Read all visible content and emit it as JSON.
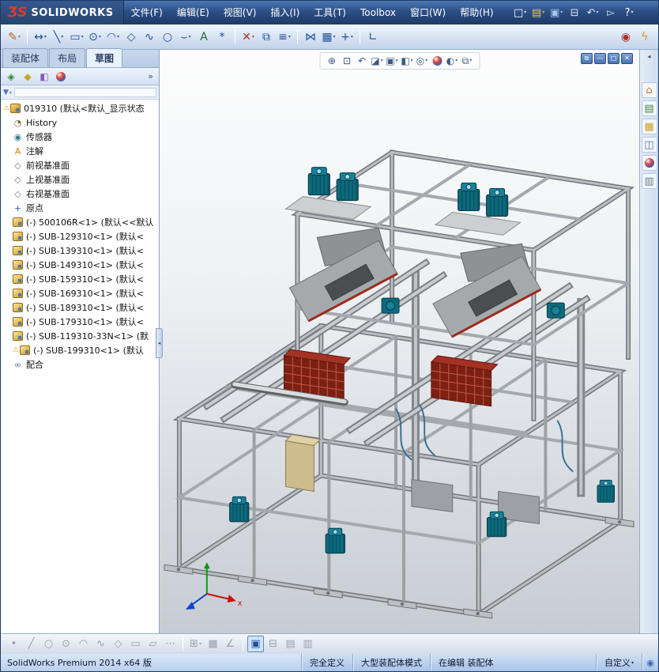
{
  "colors": {
    "titlebar_blue": "#2c4f86",
    "toolbar_blue": "#d6e2f3",
    "statusbar_blue": "#a9c4e8",
    "selection_blue": "#316ac5",
    "brand_red": "#e03a2a",
    "motor_teal": "#0c6b7d",
    "frame_gray": "#a5a9ae",
    "bin_red": "#7c2014"
  },
  "titlebar": {
    "logo_prefix": "ƷS",
    "logo_text": "SOLIDWORKS",
    "menus": [
      {
        "name": "file",
        "label": "文件(F)"
      },
      {
        "name": "edit",
        "label": "编辑(E)"
      },
      {
        "name": "view",
        "label": "视图(V)"
      },
      {
        "name": "insert",
        "label": "插入(I)"
      },
      {
        "name": "tools",
        "label": "工具(T)"
      },
      {
        "name": "toolbox",
        "label": "Toolbox"
      },
      {
        "name": "window",
        "label": "窗口(W)"
      },
      {
        "name": "help",
        "label": "帮助(H)"
      }
    ],
    "quick_icons": [
      {
        "name": "new-document-icon",
        "glyph": "□",
        "color": "#ffffff",
        "caret": true
      },
      {
        "name": "open-icon",
        "glyph": "▤",
        "color": "#f0c64a",
        "caret": true
      },
      {
        "name": "save-icon",
        "glyph": "▣",
        "color": "#a8c8f0",
        "caret": true
      },
      {
        "name": "print-icon",
        "glyph": "⊟",
        "color": "#d8e4f5"
      },
      {
        "name": "undo-icon",
        "glyph": "↶",
        "color": "#d8e4f5",
        "caret": true
      },
      {
        "name": "select-arrow-icon",
        "glyph": "▻",
        "color": "#d8e4f5"
      },
      {
        "name": "help-icon",
        "glyph": "?",
        "color": "#ffffff",
        "caret": true
      }
    ]
  },
  "sketch_toolbar": {
    "icons": [
      {
        "name": "sketch-icon",
        "glyph": "✎",
        "color": "#b8641f",
        "caret": true
      },
      {
        "name": "smart-dimension-icon",
        "glyph": "↔",
        "color": "#1f4e9e",
        "caret": true,
        "sep": true
      },
      {
        "name": "line-icon",
        "glyph": "╲",
        "color": "#1f4e9e",
        "caret": true
      },
      {
        "name": "rectangle-icon",
        "glyph": "▭",
        "color": "#1f4e9e",
        "caret": true
      },
      {
        "name": "circle-icon",
        "glyph": "⊙",
        "color": "#1f4e9e",
        "caret": true
      },
      {
        "name": "arc-icon",
        "glyph": "◠",
        "color": "#1f4e9e",
        "caret": true
      },
      {
        "name": "polygon-icon",
        "glyph": "◇",
        "color": "#1f4e9e"
      },
      {
        "name": "spline-icon",
        "glyph": "∿",
        "color": "#1f4e9e"
      },
      {
        "name": "ellipse-icon",
        "glyph": "○",
        "color": "#1f4e9e"
      },
      {
        "name": "fillet-icon",
        "glyph": "⌣",
        "color": "#1f4e9e",
        "caret": true
      },
      {
        "name": "text-icon",
        "glyph": "A",
        "color": "#1f6e2e"
      },
      {
        "name": "point-icon",
        "glyph": "*",
        "color": "#1f4e9e"
      },
      {
        "name": "trim-entities-icon",
        "glyph": "✕",
        "color": "#b03020",
        "caret": true,
        "sep": true
      },
      {
        "name": "convert-entities-icon",
        "glyph": "⧉",
        "color": "#1f4e9e"
      },
      {
        "name": "offset-entities-icon",
        "glyph": "≡",
        "color": "#1f4e9e",
        "caret": true
      },
      {
        "name": "mirror-entities-icon",
        "glyph": "⋈",
        "color": "#1f4e9e",
        "sep": true
      },
      {
        "name": "linear-pattern-icon",
        "glyph": "▦",
        "color": "#1f4e9e",
        "caret": true
      },
      {
        "name": "move-entities-icon",
        "glyph": "+",
        "color": "#1f4e9e",
        "caret": true
      },
      {
        "name": "display-relations-icon",
        "glyph": "∟",
        "color": "#1f4e9e",
        "sep": true
      }
    ],
    "right_icons": [
      {
        "name": "options-icon",
        "glyph": "◉",
        "color": "#b03020"
      },
      {
        "name": "rebuild-lightning-icon",
        "glyph": "ϟ",
        "color": "#d4a017"
      }
    ]
  },
  "command_tabs": [
    {
      "name": "assembly",
      "label": "装配体",
      "active": false
    },
    {
      "name": "layout",
      "label": "布局",
      "active": false
    },
    {
      "name": "sketch",
      "label": "草图",
      "active": true
    }
  ],
  "feature_panel": {
    "header_icons": [
      {
        "name": "featuremanager-tab-icon",
        "glyph": "◈",
        "color": "#2f8a2f"
      },
      {
        "name": "propertymanager-tab-icon",
        "glyph": "◆",
        "color": "#c8a227"
      },
      {
        "name": "configurationmanager-tab-icon",
        "glyph": "◧",
        "color": "#8a5ab8"
      },
      {
        "name": "displaymanager-tab-icon",
        "glyph": "",
        "cls": "ball"
      }
    ],
    "header_more_glyph": "»",
    "tree": {
      "items": [
        {
          "name": "root-assembly",
          "icon": "assembly-root-icon",
          "icls": "ic-cmp-root",
          "label": "019310 (默认<默认_显示状态",
          "warn": true,
          "lvl": 0
        },
        {
          "name": "history",
          "icon": "history-icon",
          "glyph": "◔",
          "icolor": "#7a6a3a",
          "label": "History",
          "lvl": 1
        },
        {
          "name": "sensors",
          "icon": "sensors-icon",
          "glyph": "◉",
          "icolor": "#3a7a8a",
          "label": "传感器",
          "lvl": 1
        },
        {
          "name": "annotations",
          "icon": "annotations-icon",
          "glyph": "A",
          "icolor": "#c08a10",
          "label": "注解",
          "lvl": 1
        },
        {
          "name": "front-plane",
          "icon": "plane-icon",
          "glyph": "◇",
          "icolor": "#6a7a90",
          "label": "前视基准面",
          "lvl": 1
        },
        {
          "name": "top-plane",
          "icon": "plane-icon",
          "glyph": "◇",
          "icolor": "#6a7a90",
          "label": "上视基准面",
          "lvl": 1
        },
        {
          "name": "right-plane",
          "icon": "plane-icon",
          "glyph": "◇",
          "icolor": "#6a7a90",
          "label": "右视基准面",
          "lvl": 1
        },
        {
          "name": "origin",
          "icon": "origin-icon",
          "glyph": "+",
          "icolor": "#2b5fb0",
          "label": "原点",
          "lvl": 1
        },
        {
          "name": "component-500106R",
          "icon": "component-icon",
          "icls": "ic-cmp",
          "label": "(-) 500106R<1> (默认<<默认",
          "lvl": 1
        },
        {
          "name": "component-SUB-129310",
          "icon": "component-icon",
          "icls": "ic-cmp",
          "label": "(-) SUB-129310<1> (默认<",
          "lvl": 1
        },
        {
          "name": "component-SUB-139310",
          "icon": "component-icon",
          "icls": "ic-cmp",
          "label": "(-) SUB-139310<1> (默认<",
          "lvl": 1
        },
        {
          "name": "component-SUB-149310",
          "icon": "component-icon",
          "icls": "ic-cmp",
          "label": "(-) SUB-149310<1> (默认<",
          "lvl": 1
        },
        {
          "name": "component-SUB-159310",
          "icon": "component-icon",
          "icls": "ic-cmp",
          "label": "(-) SUB-159310<1> (默认<",
          "lvl": 1
        },
        {
          "name": "component-SUB-169310",
          "icon": "component-icon",
          "icls": "ic-cmp",
          "label": "(-) SUB-169310<1> (默认<",
          "lvl": 1
        },
        {
          "name": "component-SUB-189310",
          "icon": "component-icon",
          "icls": "ic-cmp",
          "label": "(-) SUB-189310<1> (默认<",
          "lvl": 1
        },
        {
          "name": "component-SUB-179310",
          "icon": "component-icon",
          "icls": "ic-cmp",
          "label": "(-) SUB-179310<1> (默认<",
          "lvl": 1
        },
        {
          "name": "component-SUB-119310-33N",
          "icon": "component-icon",
          "icls": "ic-cmp",
          "label": "(-) SUB-119310-33N<1> (默",
          "lvl": 1
        },
        {
          "name": "component-SUB-199310",
          "icon": "component-icon",
          "icls": "ic-cmp",
          "label": "(-) SUB-199310<1> (默认",
          "warn": true,
          "lvl": 1
        },
        {
          "name": "mates",
          "icon": "mates-icon",
          "glyph": "∞",
          "icolor": "#4a6a9a",
          "label": "配合",
          "lvl": 1
        }
      ]
    }
  },
  "viewport": {
    "heads_up_icons": [
      {
        "name": "zoom-fit-icon",
        "glyph": "⊕"
      },
      {
        "name": "zoom-area-icon",
        "glyph": "⊡"
      },
      {
        "name": "previous-view-icon",
        "glyph": "↶"
      },
      {
        "name": "section-view-icon",
        "glyph": "◪",
        "caret": true
      },
      {
        "name": "view-orientation-icon",
        "glyph": "▣",
        "caret": true
      },
      {
        "name": "display-style-icon",
        "glyph": "◧",
        "caret": true
      },
      {
        "name": "hide-show-items-icon",
        "glyph": "◎",
        "caret": true
      },
      {
        "name": "edit-appearance-icon",
        "glyph": "",
        "cls": "ball"
      },
      {
        "name": "apply-scene-icon",
        "glyph": "◐",
        "caret": true
      },
      {
        "name": "view-settings-icon",
        "glyph": "⧉",
        "caret": true
      }
    ],
    "window_controls": [
      {
        "name": "restore-window-icon",
        "glyph": "⧉"
      },
      {
        "name": "minimize-window-icon",
        "glyph": "—"
      },
      {
        "name": "maximize-window-icon",
        "glyph": "□"
      },
      {
        "name": "close-window-icon",
        "glyph": "✕"
      }
    ],
    "triad": {
      "x_label": "x"
    }
  },
  "task_pane": {
    "icons": [
      {
        "name": "solidworks-resources-icon",
        "glyph": "⌂",
        "color": "#c87a2a"
      },
      {
        "name": "design-library-icon",
        "glyph": "▤",
        "color": "#3f8a3f"
      },
      {
        "name": "file-explorer-icon",
        "glyph": "▦",
        "color": "#c9a227"
      },
      {
        "name": "view-palette-icon",
        "glyph": "◫",
        "color": "#4a72b8"
      },
      {
        "name": "appearances-icon",
        "glyph": "",
        "cls": "ball"
      },
      {
        "name": "custom-properties-icon",
        "glyph": "▥",
        "color": "#6a7a8a"
      }
    ]
  },
  "bottom_toolbar": {
    "icons": [
      {
        "name": "sketch-point-icon",
        "glyph": "•"
      },
      {
        "name": "sketch-line-icon",
        "glyph": "╱"
      },
      {
        "name": "sketch-circle-icon",
        "glyph": "○"
      },
      {
        "name": "sketch-perimeter-circle-icon",
        "glyph": "⊙"
      },
      {
        "name": "sketch-arc-icon",
        "glyph": "◠"
      },
      {
        "name": "sketch-spline-icon",
        "glyph": "∿"
      },
      {
        "name": "sketch-polygon-icon",
        "glyph": "◇"
      },
      {
        "name": "sketch-rectangle-icon",
        "glyph": "▭"
      },
      {
        "name": "sketch-parallelogram-icon",
        "glyph": "▱"
      },
      {
        "name": "sketch-more-icon",
        "glyph": "⋯"
      },
      {
        "name": "quick-snaps-icon",
        "glyph": "⊞",
        "caret": true,
        "sep": true
      },
      {
        "name": "grid-icon",
        "glyph": "▦"
      },
      {
        "name": "angle-snap-icon",
        "glyph": "∠"
      },
      {
        "name": "sketch-active-icon",
        "glyph": "▣",
        "active": true,
        "sep": true
      },
      {
        "name": "planes-icon",
        "glyph": "⊟"
      },
      {
        "name": "table-icon",
        "glyph": "▤"
      },
      {
        "name": "design-table-icon",
        "glyph": "▥"
      }
    ]
  },
  "statusbar": {
    "product": "SolidWorks Premium 2014 x64 版",
    "define_state": "完全定义",
    "assembly_mode": "大型装配体模式",
    "edit_state": "在编辑 装配体",
    "custom": "自定义",
    "custom_caret": "▾",
    "options_glyph": "◉"
  }
}
